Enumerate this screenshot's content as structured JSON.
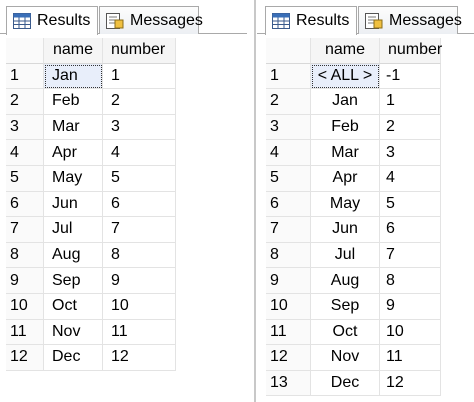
{
  "left_pane": {
    "tabs": [
      {
        "label": "Results",
        "icon": "results-grid-icon"
      },
      {
        "label": "Messages",
        "icon": "messages-icon"
      }
    ],
    "columns": [
      "name",
      "number"
    ],
    "rows": [
      {
        "idx": "1",
        "name": "Jan",
        "number": "1"
      },
      {
        "idx": "2",
        "name": "Feb",
        "number": "2"
      },
      {
        "idx": "3",
        "name": "Mar",
        "number": "3"
      },
      {
        "idx": "4",
        "name": "Apr",
        "number": "4"
      },
      {
        "idx": "5",
        "name": "May",
        "number": "5"
      },
      {
        "idx": "6",
        "name": "Jun",
        "number": "6"
      },
      {
        "idx": "7",
        "name": "Jul",
        "number": "7"
      },
      {
        "idx": "8",
        "name": "Aug",
        "number": "8"
      },
      {
        "idx": "9",
        "name": "Sep",
        "number": "9"
      },
      {
        "idx": "10",
        "name": "Oct",
        "number": "10"
      },
      {
        "idx": "11",
        "name": "Nov",
        "number": "11"
      },
      {
        "idx": "12",
        "name": "Dec",
        "number": "12"
      }
    ]
  },
  "right_pane": {
    "tabs": [
      {
        "label": "Results",
        "icon": "results-grid-icon"
      },
      {
        "label": "Messages",
        "icon": "messages-icon"
      }
    ],
    "columns": [
      "name",
      "number"
    ],
    "rows": [
      {
        "idx": "1",
        "name": "< ALL >",
        "number": "-1"
      },
      {
        "idx": "2",
        "name": "Jan",
        "number": "1"
      },
      {
        "idx": "3",
        "name": "Feb",
        "number": "2"
      },
      {
        "idx": "4",
        "name": "Mar",
        "number": "3"
      },
      {
        "idx": "5",
        "name": "Apr",
        "number": "4"
      },
      {
        "idx": "6",
        "name": "May",
        "number": "5"
      },
      {
        "idx": "7",
        "name": "Jun",
        "number": "6"
      },
      {
        "idx": "8",
        "name": "Jul",
        "number": "7"
      },
      {
        "idx": "9",
        "name": "Aug",
        "number": "8"
      },
      {
        "idx": "10",
        "name": "Sep",
        "number": "9"
      },
      {
        "idx": "11",
        "name": "Oct",
        "number": "10"
      },
      {
        "idx": "12",
        "name": "Nov",
        "number": "11"
      },
      {
        "idx": "13",
        "name": "Dec",
        "number": "12"
      }
    ]
  },
  "colors": {
    "selection_fill": "#e8eefa",
    "grid_line": "#e3e3e3",
    "tab_border": "#a9a9a9"
  }
}
